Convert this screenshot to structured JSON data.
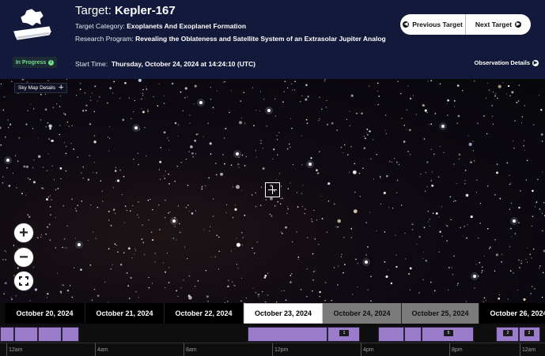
{
  "header": {
    "target_label": "Target:",
    "target_name": "Kepler-167",
    "category_label": "Target Category:",
    "category_value": "Exoplanets And Exoplanet Formation",
    "program_label": "Research Program:",
    "program_value": "Revealing the Oblateness and Satellite System of an Extrasolar Jupiter Analog",
    "start_label": "Start Time:",
    "start_value": "Thursday, October 24, 2024 at 14:24:10 (UTC)",
    "status": "In Progress",
    "prev_label": "Previous Target",
    "next_label": "Next Target",
    "obs_details_label": "Observation Details"
  },
  "sky": {
    "details_label": "Sky Map Details"
  },
  "timeline": {
    "dates": [
      {
        "label": "October 20, 2024",
        "state": "past"
      },
      {
        "label": "October 21, 2024",
        "state": "past"
      },
      {
        "label": "October 22, 2024",
        "state": "past"
      },
      {
        "label": "October 23, 2024",
        "state": "active"
      },
      {
        "label": "October 24, 2024",
        "state": "future"
      },
      {
        "label": "October 25, 2024",
        "state": "future"
      },
      {
        "label": "October 26, 2024",
        "state": "past"
      }
    ],
    "segment_labels": [
      "1",
      "5",
      "2",
      "2"
    ],
    "hours": [
      "12am",
      "4am",
      "8am",
      "12pm",
      "4pm",
      "8pm",
      "12am"
    ]
  },
  "colors": {
    "header_bg": "#13193a",
    "status_green": "#6fe08a",
    "segment_purple": "#9b7ccb",
    "active_tab": "#ffffff",
    "future_tab": "#7b7b7b"
  },
  "icons": {
    "logo": "telescope-logo",
    "prev": "arrow-left-circle-icon",
    "next": "arrow-right-circle-icon",
    "info": "info-icon",
    "calendar": "calendar-icon",
    "zoom_in": "plus-icon",
    "zoom_out": "minus-icon",
    "fullscreen": "fullscreen-icon"
  }
}
